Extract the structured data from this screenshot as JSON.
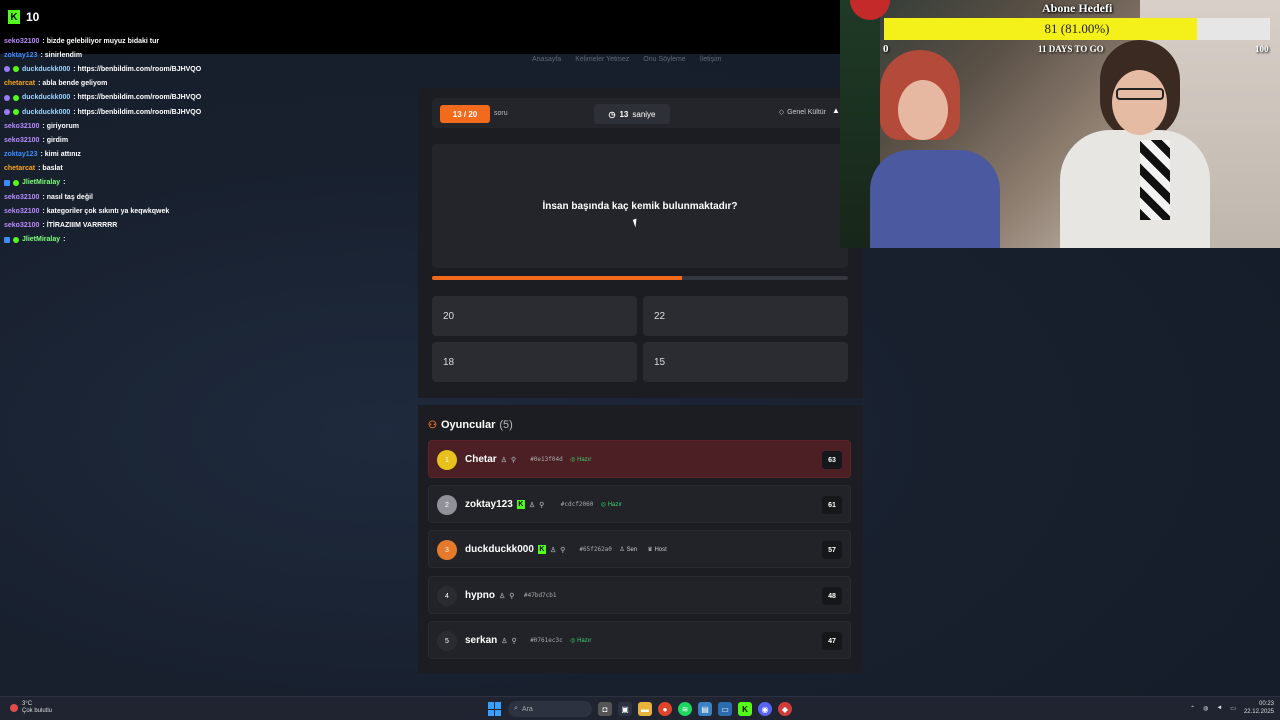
{
  "stream": {
    "viewer_count": "10"
  },
  "site_nav": [
    "Anasayfa",
    "Kelimeler Yetmez",
    "Onu Söyleme",
    "İletişim"
  ],
  "chat": [
    {
      "user": "seko32100",
      "msg": ": bizde gelebiliyor muyuz bidaki tur",
      "badge": "",
      "color": "#b98bff"
    },
    {
      "user": "zoktay123",
      "msg": ": sinirlendim",
      "badge": "",
      "color": "#3d8bff"
    },
    {
      "user": "duckduckk000",
      "msg": ": https://benbildim.com/room/BJHVQO",
      "badge": "sub",
      "color": "#9fd3ff"
    },
    {
      "user": "chetarcat",
      "msg": ": abla bende geliyom",
      "badge": "",
      "color": "#f5a623"
    },
    {
      "user": "duckduckk000",
      "msg": ": https://benbildim.com/room/BJHVQO",
      "badge": "sub",
      "color": "#9fd3ff"
    },
    {
      "user": "duckduckk000",
      "msg": ": https://benbildim.com/room/BJHVQO",
      "badge": "sub",
      "color": "#9fd3ff"
    },
    {
      "user": "seko32100",
      "msg": ": giriyorum",
      "badge": "",
      "color": "#b98bff"
    },
    {
      "user": "seko32100",
      "msg": ": girdim",
      "badge": "",
      "color": "#b98bff"
    },
    {
      "user": "zoktay123",
      "msg": ": kimi attınız",
      "badge": "",
      "color": "#3d8bff"
    },
    {
      "user": "chetarcat",
      "msg": ": baslat",
      "badge": "",
      "color": "#f5a623"
    },
    {
      "user": "JlietMiralay",
      "msg": ":",
      "badge": "mod",
      "color": "#7dff7d"
    },
    {
      "user": "seko32100",
      "msg": ": nasıl taş değil",
      "badge": "",
      "color": "#b98bff"
    },
    {
      "user": "seko32100",
      "msg": ": kategoriler çok sıkıntı ya keqwkqwek",
      "badge": "",
      "color": "#b98bff"
    },
    {
      "user": "seko32100",
      "msg": ": İTİRAZIIIM VARRRRR",
      "badge": "",
      "color": "#b98bff"
    },
    {
      "user": "JlietMiralay",
      "msg": ":",
      "badge": "mod",
      "color": "#7dff7d"
    }
  ],
  "question": {
    "counter": "13 / 20",
    "counter_label": "soru",
    "timer_value": "13",
    "timer_label": "saniye",
    "category": "Genel Kültür",
    "text": "İnsan başında kaç kemik bulunmaktadır?",
    "progress": 0.6,
    "answers": [
      "20",
      "22",
      "18",
      "15"
    ]
  },
  "players": {
    "title": "Oyuncular",
    "count": "(5)",
    "list": [
      {
        "rank": "1",
        "name": "Chetar",
        "code": "#0e13f04d",
        "status": "Hazır",
        "kick": false,
        "extra": [],
        "score": "63"
      },
      {
        "rank": "2",
        "name": "zoktay123",
        "code": "#cdcf2060",
        "status": "Hazır",
        "kick": true,
        "extra": [],
        "score": "61"
      },
      {
        "rank": "3",
        "name": "duckduckk000",
        "code": "#65f262a0",
        "status": "",
        "kick": true,
        "extra": [
          "Sen",
          "Host"
        ],
        "score": "57"
      },
      {
        "rank": "4",
        "name": "hypno",
        "code": "#47bd7cb1",
        "status": "",
        "kick": false,
        "extra": [],
        "score": "48"
      },
      {
        "rank": "5",
        "name": "serkan",
        "code": "#0761ec3c",
        "status": "Hazır",
        "kick": false,
        "extra": [],
        "score": "47"
      }
    ]
  },
  "goal": {
    "title": "Abone Hedefi",
    "progress_text": "81 (81.00%)",
    "progress": 0.81,
    "min": "0",
    "max": "100",
    "days": "11 DAYS TO GO"
  },
  "taskbar": {
    "weather_temp": "3°C",
    "weather_desc": "Çok bulutlu",
    "search_placeholder": "Ara",
    "time": "00:23",
    "date": "22.12.2025"
  },
  "colors": {
    "accent": "#f26b1d",
    "kick_green": "#53fc18",
    "ready_green": "#3ecf6a",
    "goal_yellow": "#f4f01a"
  }
}
